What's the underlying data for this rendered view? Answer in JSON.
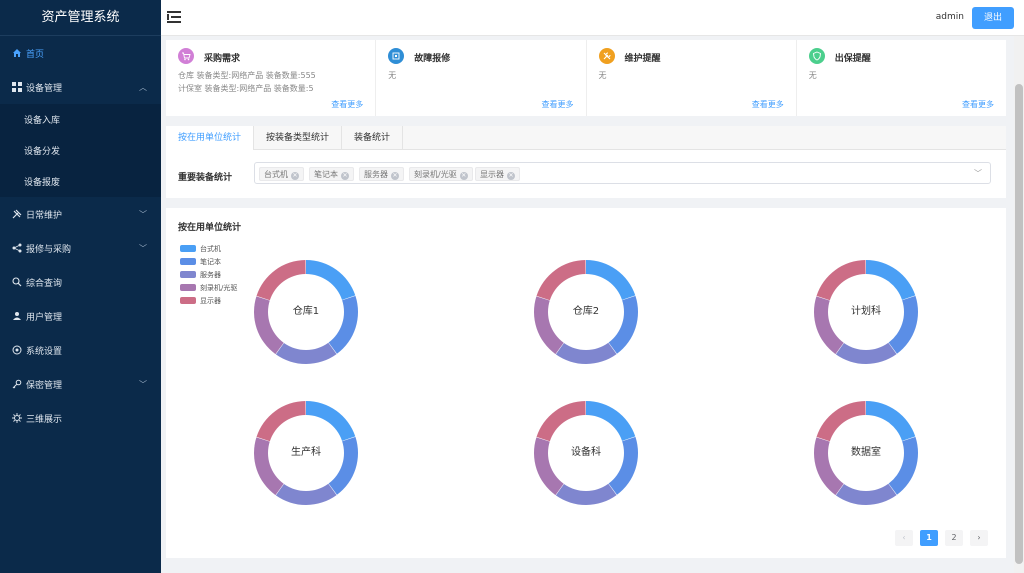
{
  "app": {
    "title": "资产管理系统"
  },
  "sidebar": {
    "items": [
      {
        "label": "首页",
        "icon": "home-icon",
        "active": true
      },
      {
        "label": "设备管理",
        "icon": "grid-icon",
        "expanded": true,
        "children": [
          {
            "label": "设备入库"
          },
          {
            "label": "设备分发"
          },
          {
            "label": "设备报废"
          }
        ]
      },
      {
        "label": "日常维护",
        "icon": "tools-icon",
        "has_children": true
      },
      {
        "label": "报修与采购",
        "icon": "share-icon",
        "has_children": true
      },
      {
        "label": "综合查询",
        "icon": "search-icon"
      },
      {
        "label": "用户管理",
        "icon": "users-icon"
      },
      {
        "label": "系统设置",
        "icon": "settings-icon"
      },
      {
        "label": "保密管理",
        "icon": "key-icon",
        "has_children": true
      },
      {
        "label": "三维展示",
        "icon": "gear-icon"
      }
    ]
  },
  "header": {
    "user": "admin",
    "logout_label": "退出"
  },
  "cards": [
    {
      "title": "采购需求",
      "icon": "cart-icon",
      "color": "#d17fd6",
      "lines": [
        "仓库 装备类型:网络产品 装备数量:555",
        "计保室 装备类型:网络产品 装备数量:5"
      ],
      "more": "查看更多"
    },
    {
      "title": "故障报修",
      "icon": "repair-icon",
      "color": "#2f8ed6",
      "lines": [
        "无"
      ],
      "more": "查看更多"
    },
    {
      "title": "维护提醒",
      "icon": "wrench-icon",
      "color": "#f0a020",
      "lines": [
        "无"
      ],
      "more": "查看更多"
    },
    {
      "title": "出保提醒",
      "icon": "shield-icon",
      "color": "#4ccf8d",
      "lines": [
        "无"
      ],
      "more": "查看更多"
    }
  ],
  "tabs": [
    {
      "label": "按在用单位统计",
      "active": true
    },
    {
      "label": "按装备类型统计"
    },
    {
      "label": "装备统计"
    }
  ],
  "filter": {
    "label": "重要装备统计",
    "tags": [
      "台式机",
      "笔记本",
      "服务器",
      "刻录机/光驱",
      "显示器"
    ]
  },
  "chart_section": {
    "title": "按在用单位统计"
  },
  "chart_data": {
    "type": "pie",
    "legend": {
      "placement": "top-left",
      "entries": [
        {
          "name": "台式机",
          "color": "#4a9ff5"
        },
        {
          "name": "笔记本",
          "color": "#5b8ee6"
        },
        {
          "name": "服务器",
          "color": "#7f86cf"
        },
        {
          "name": "刻录机/光驱",
          "color": "#a777b0"
        },
        {
          "name": "显示器",
          "color": "#cc6d86"
        }
      ]
    },
    "charts": [
      {
        "name": "仓库1",
        "values": [
          20,
          20,
          20,
          20,
          20
        ]
      },
      {
        "name": "仓库2",
        "values": [
          20,
          20,
          20,
          20,
          20
        ]
      },
      {
        "name": "计划科",
        "values": [
          20,
          20,
          20,
          20,
          20
        ]
      },
      {
        "name": "生产科",
        "values": [
          20,
          20,
          20,
          20,
          20
        ]
      },
      {
        "name": "设备科",
        "values": [
          20,
          20,
          20,
          20,
          20
        ]
      },
      {
        "name": "数据室",
        "values": [
          20,
          20,
          20,
          20,
          20
        ]
      }
    ]
  },
  "pagination": {
    "prev": "‹",
    "pages": [
      "1",
      "2"
    ],
    "current": "1",
    "next": "›"
  }
}
